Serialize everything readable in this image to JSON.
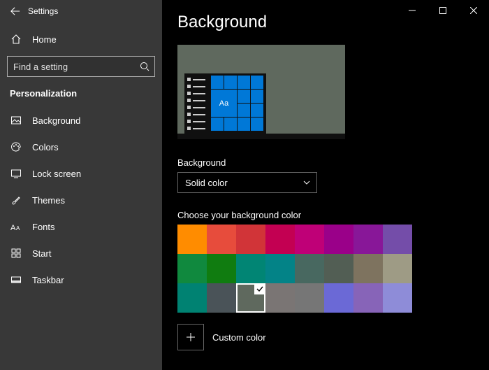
{
  "window": {
    "title": "Settings"
  },
  "home": {
    "label": "Home"
  },
  "search": {
    "placeholder": "Find a setting"
  },
  "section": {
    "header": "Personalization"
  },
  "nav": {
    "items": [
      {
        "label": "Background"
      },
      {
        "label": "Colors"
      },
      {
        "label": "Lock screen"
      },
      {
        "label": "Themes"
      },
      {
        "label": "Fonts"
      },
      {
        "label": "Start"
      },
      {
        "label": "Taskbar"
      }
    ]
  },
  "page": {
    "title": "Background",
    "preview": {
      "sample_text": "Aa",
      "bg_color": "#5f695e"
    },
    "dropdown": {
      "label": "Background",
      "value": "Solid color"
    },
    "swatch_label": "Choose your background color",
    "selected_color": "#5f695e",
    "colors": [
      "#ff8c00",
      "#e74c3c",
      "#d13438",
      "#c30052",
      "#bf0077",
      "#9a0089",
      "#881798",
      "#744da9",
      "#10893e",
      "#107c10",
      "#018574",
      "#038387",
      "#486860",
      "#525e54",
      "#7e735f",
      "#9e9b85",
      "#008272",
      "#4a5358",
      "#5f695e",
      "#7a7574",
      "#767676",
      "#6b69d6",
      "#8764b8",
      "#8e8cd8"
    ],
    "custom": {
      "label": "Custom color"
    }
  }
}
